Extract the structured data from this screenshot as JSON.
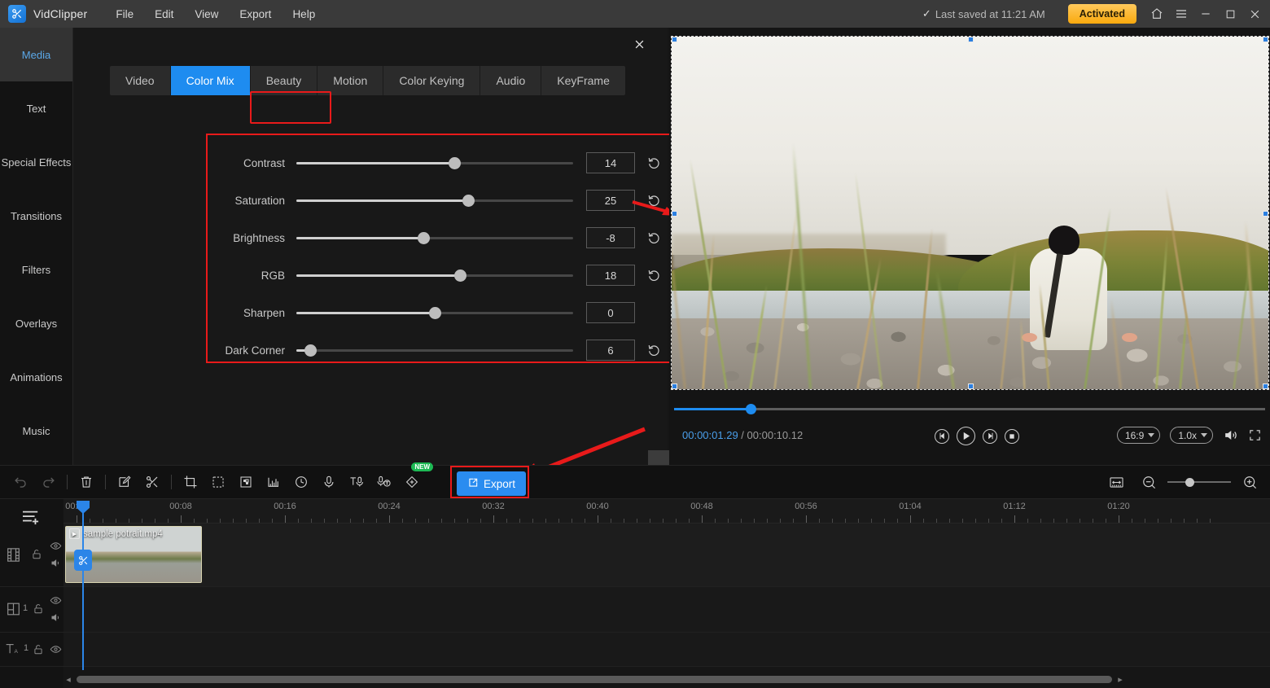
{
  "titlebar": {
    "app_name": "VidClipper",
    "logo_icon": "scissors-video-logo-icon",
    "menus": [
      "File",
      "Edit",
      "View",
      "Export",
      "Help"
    ],
    "saved_status": "Last saved at 11:21 AM",
    "saved_check_icon": "check-icon",
    "license_badge": "Activated",
    "home_icon": "home-icon",
    "hamburger_icon": "hamburger-menu-icon",
    "minimize_icon": "minimize-icon",
    "maximize_icon": "maximize-icon",
    "close_icon": "close-icon"
  },
  "sidebar": {
    "items": [
      {
        "label": "Media",
        "active": true
      },
      {
        "label": "Text",
        "active": false
      },
      {
        "label": "Special Effects",
        "active": false
      },
      {
        "label": "Transitions",
        "active": false
      },
      {
        "label": "Filters",
        "active": false
      },
      {
        "label": "Overlays",
        "active": false
      },
      {
        "label": "Animations",
        "active": false
      },
      {
        "label": "Music",
        "active": false
      }
    ]
  },
  "panel": {
    "close_icon": "close-icon",
    "tabs": [
      {
        "label": "Video",
        "active": false
      },
      {
        "label": "Color Mix",
        "active": true
      },
      {
        "label": "Beauty",
        "active": false
      },
      {
        "label": "Motion",
        "active": false
      },
      {
        "label": "Color Keying",
        "active": false
      },
      {
        "label": "Audio",
        "active": false
      },
      {
        "label": "KeyFrame",
        "active": false
      }
    ],
    "reset_label": "Reset",
    "reset_icon": "reset-arrow-icon",
    "sliders": [
      {
        "label": "Contrast",
        "value": "14",
        "pct": 57,
        "has_reset": true
      },
      {
        "label": "Saturation",
        "value": "25",
        "pct": 62,
        "has_reset": true
      },
      {
        "label": "Brightness",
        "value": "-8",
        "pct": 46,
        "has_reset": true
      },
      {
        "label": "RGB",
        "value": "18",
        "pct": 59,
        "has_reset": true
      },
      {
        "label": "Sharpen",
        "value": "0",
        "pct": 50,
        "has_reset": false
      },
      {
        "label": "Dark Corner",
        "value": "6",
        "pct": 5,
        "has_reset": true
      }
    ]
  },
  "preview": {
    "scrub_pct": 13,
    "current_time": "00:00:01.29",
    "time_separator": " / ",
    "total_time": "00:00:10.12",
    "prev_frame_icon": "previous-frame-icon",
    "play_icon": "play-icon",
    "next_frame_icon": "next-frame-icon",
    "stop_icon": "stop-icon",
    "aspect_ratio": "16:9",
    "playback_speed": "1.0x",
    "volume_icon": "volume-icon",
    "fullscreen_icon": "fullscreen-icon"
  },
  "toolbar": {
    "items": [
      {
        "name": "undo-icon",
        "disabled": true
      },
      {
        "name": "redo-icon",
        "disabled": true
      },
      {
        "sep": true
      },
      {
        "name": "delete-trash-icon",
        "disabled": false
      },
      {
        "sep": true
      },
      {
        "name": "edit-pencil-icon",
        "disabled": false
      },
      {
        "name": "scissors-split-icon",
        "disabled": false
      },
      {
        "sep": true
      },
      {
        "name": "crop-icon",
        "disabled": false
      },
      {
        "name": "mask-selection-icon",
        "disabled": false
      },
      {
        "name": "mosaic-icon",
        "disabled": false
      },
      {
        "name": "audio-waveform-icon",
        "disabled": false
      },
      {
        "name": "speed-clock-icon",
        "disabled": false
      },
      {
        "name": "voice-record-icon",
        "disabled": false
      },
      {
        "name": "text-to-speech-icon",
        "disabled": false
      },
      {
        "name": "speech-to-text-icon",
        "disabled": false
      },
      {
        "name": "auto-enhance-icon",
        "disabled": false,
        "badge": "NEW"
      }
    ],
    "export_label": "Export",
    "export_icon": "export-share-icon",
    "fit-timeline_icon": "fit-to-timeline-icon",
    "zoom_out_icon": "zoom-out-icon",
    "zoom_in_icon": "zoom-in-icon",
    "zoom_level_pct": 28
  },
  "timeline": {
    "add_track_icon": "add-track-icon",
    "ruler_ticks": [
      "00:00",
      "00:08",
      "00:16",
      "00:24",
      "00:32",
      "00:40",
      "00:48",
      "00:56",
      "01:04",
      "01:12",
      "01:20"
    ],
    "playhead_time_pct": 1.5,
    "split_icon": "split-scissors-icon",
    "tracks": [
      {
        "type": "video",
        "icon": "film-strip-icon",
        "count": "",
        "eye_icon": "eye-visible-icon",
        "lock_icon": "lock-open-icon",
        "audio_icon": "speaker-icon",
        "clip": {
          "name": "sample potrait.mp4",
          "type_icon": "video-clip-icon"
        }
      },
      {
        "type": "overlay",
        "icon": "pip-overlay-icon",
        "count": "1",
        "eye_icon": "eye-visible-icon",
        "lock_icon": "lock-open-icon",
        "audio_icon": "speaker-icon",
        "clip": null
      },
      {
        "type": "text",
        "icon": "text-track-icon",
        "count": "1",
        "eye_icon": "eye-visible-icon",
        "lock_icon": "lock-open-icon",
        "audio_icon": "",
        "clip": null
      }
    ],
    "scroll_left_icon": "scroll-left-icon",
    "scroll_right_icon": "scroll-right-icon"
  },
  "annotations": {
    "accent_red": "#e81a1a",
    "accent_blue": "#1e8cf0",
    "badge_amber": "#f9a90d"
  }
}
